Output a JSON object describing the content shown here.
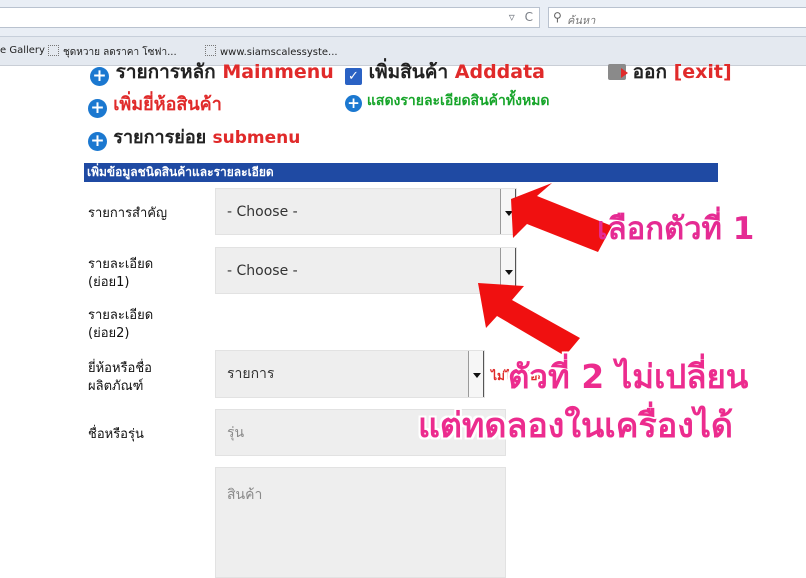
{
  "browser": {
    "search_placeholder": "ค้นหา",
    "bookmarks": [
      {
        "label": "e Gallery"
      },
      {
        "label": "ชุดหวาย ลดราคา โซฟา..."
      },
      {
        "label": "www.siamscalessyste..."
      }
    ]
  },
  "menu": {
    "main_th": "รายการหลัก",
    "main_en": "Mainmenu",
    "add_th": "เพิ่มสินค้า",
    "add_en": "Adddata",
    "exit_th": "ออก",
    "exit_en": "[exit]",
    "add_brand": "เพิ่มยี่ห้อสินค้า",
    "show_all": "แสดงรายละเอียดสินค้าทั้งหมด",
    "submenu_th": "รายการย่อย",
    "submenu_en": "submenu"
  },
  "form": {
    "header": "เพิ่มข้อมูลชนิดสินค้าและรายละเอียด",
    "fields": {
      "main_item_label": "รายการสำคัญ",
      "main_item_value": "- Choose -",
      "detail1_label_1": "รายละเอียด",
      "detail1_label_2": "(ย่อย1)",
      "detail1_value": "- Choose -",
      "detail2_label_1": "รายละเอียด",
      "detail2_label_2": "(ย่อย2)",
      "brand_label_1": "ยี่ห้อหรือชื่อ",
      "brand_label_2": "ผลิตภัณฑ์",
      "brand_value": "รายการ",
      "brand_required": "ไม่ได้เลือก",
      "model_label": "ชื่อหรือรุ่น",
      "model_placeholder": "รุ่น",
      "product_placeholder": "สินค้า"
    }
  },
  "annotations": {
    "pick_first": "เลือกตัวที่ 1",
    "second_unchanged": "ตัวที่ 2 ไม่เปลี่ยน",
    "local_test_ok": "แต่ทดลองในเครื่องได้"
  },
  "colors": {
    "accent_blue": "#1f4aa3",
    "red": "#e02a2a",
    "green": "#17a52a",
    "annotation_pink": "#e52b93"
  }
}
